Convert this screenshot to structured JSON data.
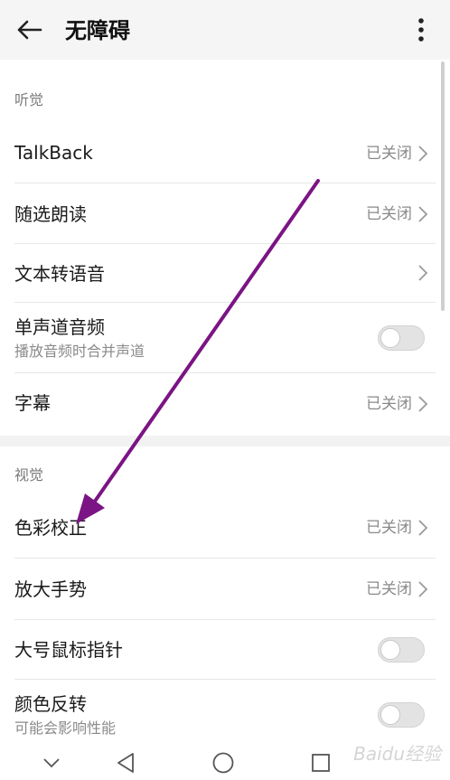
{
  "header": {
    "title": "无障碍"
  },
  "sections": [
    {
      "label": "听觉"
    },
    {
      "label": "视觉"
    }
  ],
  "rows": [
    {
      "title": "TalkBack",
      "status": "已关闭"
    },
    {
      "title": "随选朗读",
      "status": "已关闭"
    },
    {
      "title": "文本转语音"
    },
    {
      "title": "单声道音频",
      "subtitle": "播放音频时合并声道"
    },
    {
      "title": "字幕",
      "status": "已关闭"
    },
    {
      "title": "色彩校正",
      "status": "已关闭"
    },
    {
      "title": "放大手势",
      "status": "已关闭"
    },
    {
      "title": "大号鼠标指针"
    },
    {
      "title": "颜色反转",
      "subtitle": "可能会影响性能"
    }
  ],
  "toggles": {
    "mono_audio": false,
    "large_pointer": false,
    "color_inversion": false
  },
  "colors": {
    "annotation_arrow": "#7b1484",
    "appbar_bg": "#f5f5f5"
  },
  "watermark": "Baidu经验"
}
